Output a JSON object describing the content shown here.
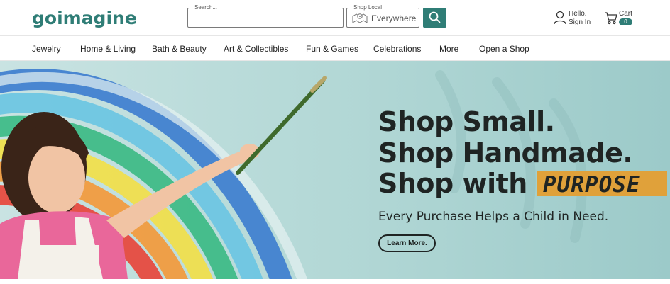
{
  "brand": {
    "logo_text": "goimagine",
    "primary_color": "#2f7d76",
    "accent_color": "#e0a13a"
  },
  "header": {
    "search": {
      "legend": "Search...",
      "value": "",
      "icon": "search-icon"
    },
    "shop_local": {
      "legend": "Shop Local",
      "value": "Everywhere",
      "icon": "map-pin-icon"
    },
    "account": {
      "line1": "Hello.",
      "line2": "Sign In",
      "icon": "user-icon"
    },
    "cart": {
      "label": "Cart",
      "count": "0",
      "icon": "cart-icon"
    }
  },
  "nav": {
    "items": [
      "Jewelry",
      "Home & Living",
      "Bath & Beauty",
      "Art & Collectibles",
      "Fun & Games",
      "Celebrations",
      "More",
      "Open a Shop"
    ]
  },
  "hero": {
    "line1": "Shop Small.",
    "line2": "Shop Handmade.",
    "line3": "Shop with",
    "highlight": "PURPOSE",
    "subtitle": "Every Purchase Helps a Child in Need.",
    "cta": "Learn More."
  }
}
